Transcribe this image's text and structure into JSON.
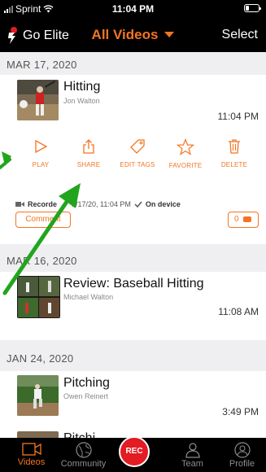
{
  "status": {
    "carrier": "Sprint",
    "time": "11:04 PM"
  },
  "nav": {
    "brand": "Go Elite",
    "title": "All Videos",
    "select": "Select"
  },
  "sections": [
    {
      "date": "MAR 17, 2020"
    },
    {
      "date": "MAR 16, 2020"
    },
    {
      "date": "JAN 24, 2020"
    }
  ],
  "videos": [
    {
      "title": "Hitting",
      "author": "Jon Walton",
      "time": "11:04 PM"
    },
    {
      "title": "Review: Baseball Hitting",
      "author": "Michael Walton",
      "time": "11:08 AM"
    },
    {
      "title": "Pitching",
      "author": "Owen Reinert",
      "time": "3:49 PM"
    },
    {
      "title": "Pitchi"
    }
  ],
  "actions": {
    "play": "PLAY",
    "share": "SHARE",
    "edit_tags": "EDIT TAGS",
    "favorite": "FAVORITE",
    "delete": "DELETE"
  },
  "recorded": {
    "prefix": "Recorde",
    "date": "3/17/20, 11:04 PM",
    "location": "On device"
  },
  "comment": {
    "label": "Comment",
    "count": "0"
  },
  "tabs": {
    "videos": "Videos",
    "community": "Community",
    "rec": "REC",
    "team": "Team",
    "profile": "Profile"
  },
  "colors": {
    "accent": "#f47521",
    "rec": "#e31b23",
    "arrow": "#22a51c"
  },
  "icons": [
    "wifi-icon",
    "battery-icon",
    "play-icon",
    "share-icon",
    "tag-icon",
    "star-icon",
    "trash-icon",
    "camera-icon",
    "checkmark-icon",
    "comment-bubble-icon",
    "video-camera-icon",
    "globe-icon",
    "team-icon",
    "profile-icon"
  ]
}
